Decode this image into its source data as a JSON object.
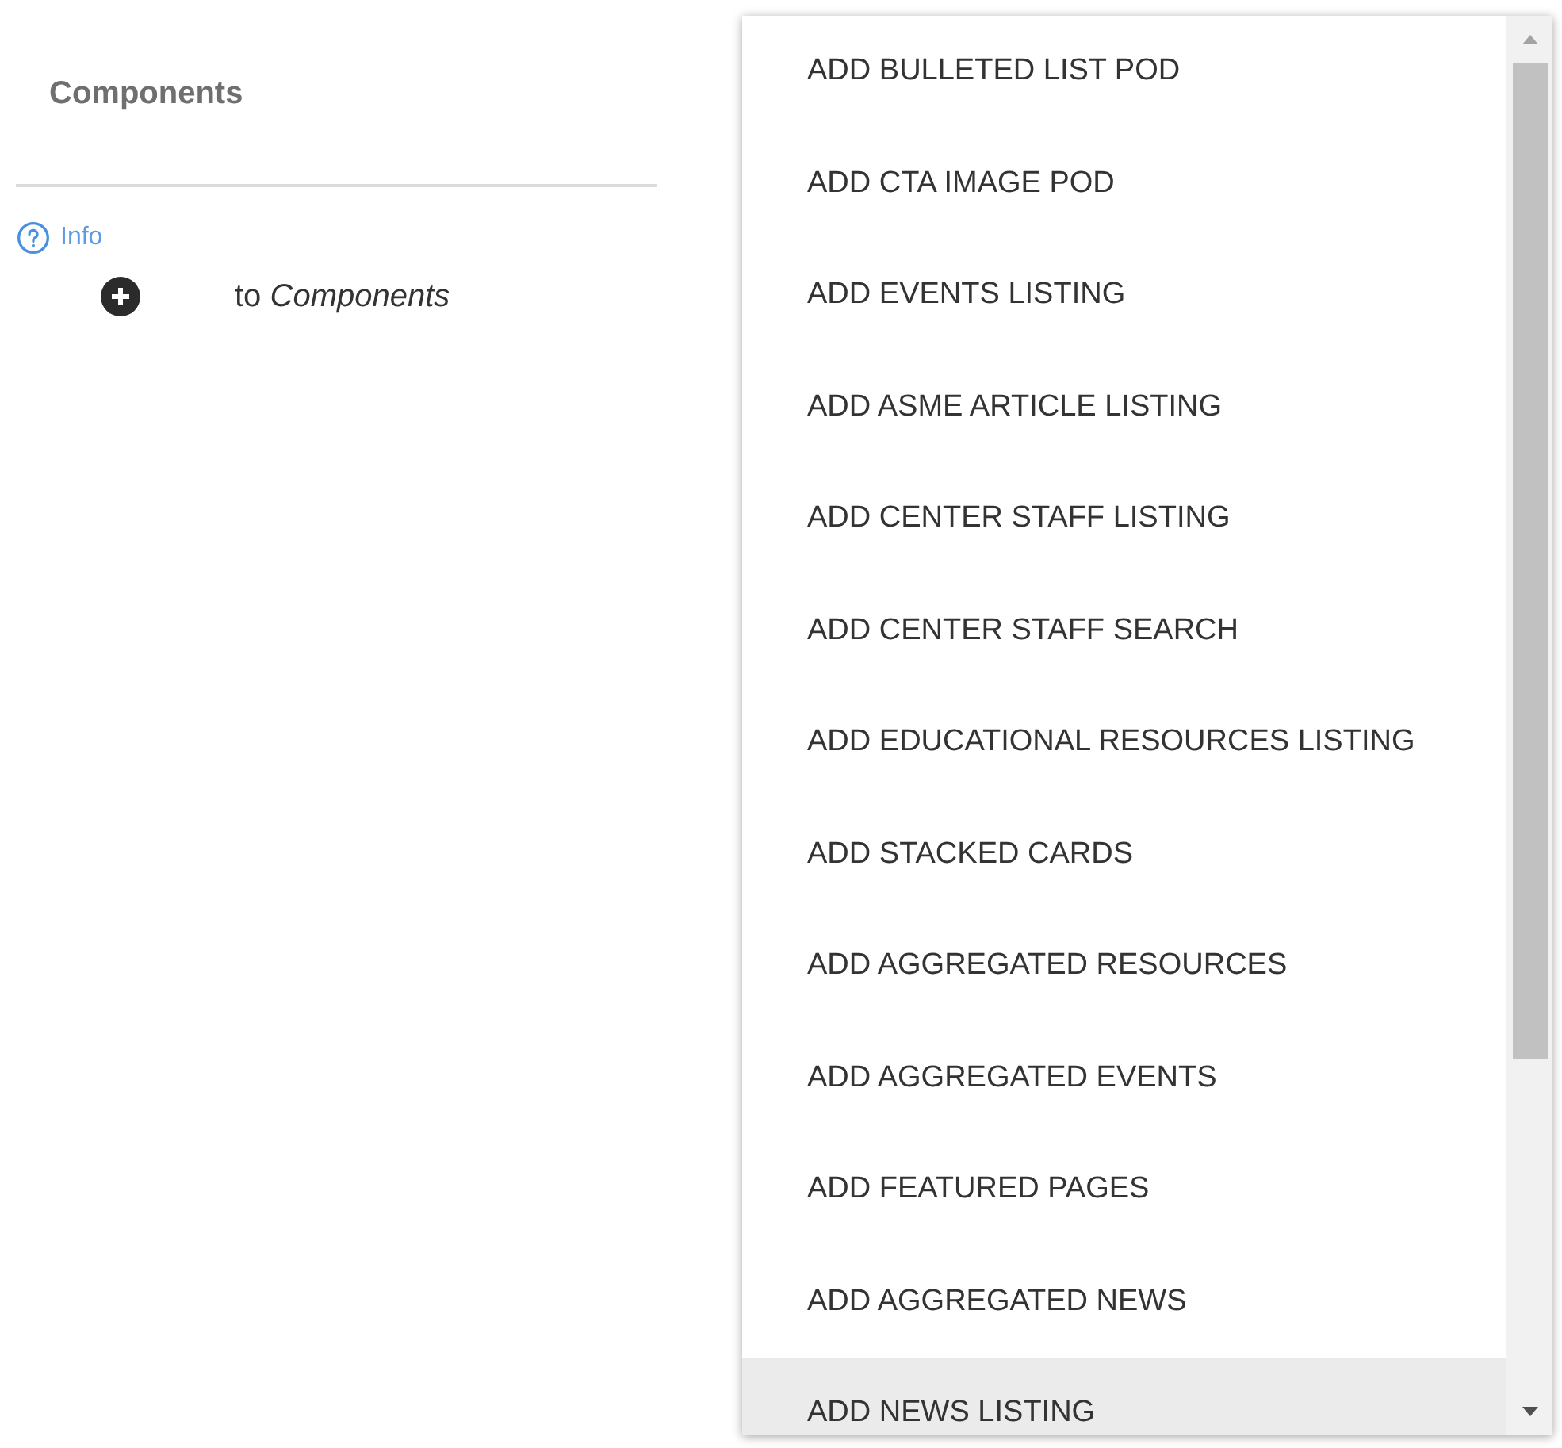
{
  "panel": {
    "title": "Components",
    "info_link": "Info",
    "add_hint": "to *Components*"
  },
  "menu": {
    "items": [
      {
        "label": "ADD BULLETED LIST POD",
        "highlighted": false
      },
      {
        "label": "ADD CTA IMAGE POD",
        "highlighted": false
      },
      {
        "label": "ADD EVENTS LISTING",
        "highlighted": false
      },
      {
        "label": "ADD ASME ARTICLE LISTING",
        "highlighted": false
      },
      {
        "label": "ADD CENTER STAFF LISTING",
        "highlighted": false
      },
      {
        "label": "ADD CENTER STAFF SEARCH",
        "highlighted": false
      },
      {
        "label": "ADD EDUCATIONAL RESOURCES LISTING",
        "highlighted": false
      },
      {
        "label": "ADD STACKED CARDS",
        "highlighted": false
      },
      {
        "label": "ADD AGGREGATED RESOURCES",
        "highlighted": false
      },
      {
        "label": "ADD AGGREGATED EVENTS",
        "highlighted": false
      },
      {
        "label": "ADD FEATURED PAGES",
        "highlighted": false
      },
      {
        "label": "ADD AGGREGATED NEWS",
        "highlighted": false
      },
      {
        "label": "ADD NEWS LISTING",
        "highlighted": true
      }
    ]
  }
}
